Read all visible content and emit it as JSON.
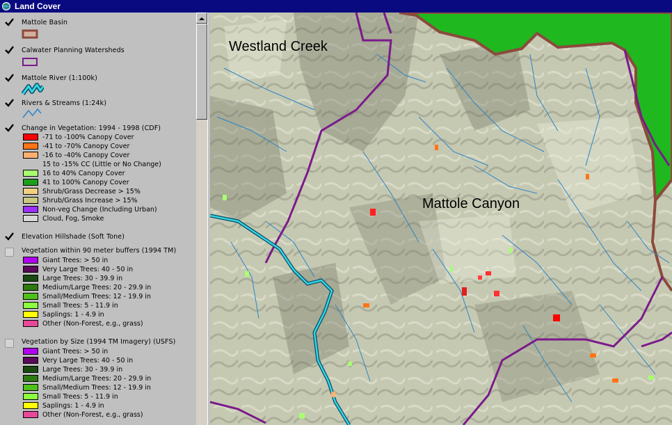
{
  "window": {
    "title": "Land Cover"
  },
  "toc": {
    "layers": [
      {
        "name": "Mattole Basin",
        "checked": true
      },
      {
        "name": "Calwater Planning Watersheds",
        "checked": true
      },
      {
        "name": "Mattole River (1:100k)",
        "checked": true
      },
      {
        "name": "Rivers & Streams (1:24k)",
        "checked": true
      },
      {
        "name": "Change in Vegetation: 1994 - 1998 (CDF)",
        "checked": true,
        "legend": [
          {
            "label": "-71 to -100% Canopy Cover",
            "color": "#ff0000"
          },
          {
            "label": "-41 to -70% Canopy Cover",
            "color": "#ff7518"
          },
          {
            "label": "-16 to -40% Canopy Cover",
            "color": "#ffb070"
          },
          {
            "label": "15 to -15% CC (Little or No Change)",
            "color": ""
          },
          {
            "label": "16 to 40% Canopy Cover",
            "color": "#a8ff70"
          },
          {
            "label": "41 to 100% Canopy Cover",
            "color": "#1e9e1e"
          },
          {
            "label": "Shrub/Grass Decrease > 15%",
            "color": "#f0d080"
          },
          {
            "label": "Shrub/Grass Increase > 15%",
            "color": "#c8c880"
          },
          {
            "label": "Non-veg Change (Including Urban)",
            "color": "#9b30ff"
          },
          {
            "label": "Cloud, Fog, Smoke",
            "color": "#d8d8d8"
          }
        ]
      },
      {
        "name": "Elevation Hillshade (Soft Tone)",
        "checked": true
      },
      {
        "name": "Vegetation within 90 meter buffers (1994 TM)",
        "checked": false,
        "legend": [
          {
            "label": "Giant Trees: > 50 in",
            "color": "#b000f0"
          },
          {
            "label": "Very Large Trees: 40 - 50 in",
            "color": "#5a0a5a"
          },
          {
            "label": "Large Trees: 30 - 39.9 in",
            "color": "#1a4a10"
          },
          {
            "label": "Medium/Large Trees: 20 - 29.9 in",
            "color": "#2e7a10"
          },
          {
            "label": "Small/Medium Trees: 12 - 19.9 in",
            "color": "#4ec01a"
          },
          {
            "label": "Small Trees: 5 - 11.9 in",
            "color": "#8cff40"
          },
          {
            "label": "Saplings: 1 - 4.9 in",
            "color": "#ffff00"
          },
          {
            "label": "Other (Non-Forest, e.g., grass)",
            "color": "#e8489a"
          }
        ]
      },
      {
        "name": "Vegetation by Size (1994 TM Imagery) (USFS)",
        "checked": false,
        "legend": [
          {
            "label": "Giant Trees: > 50 in",
            "color": "#b000f0"
          },
          {
            "label": "Very Large Trees: 40 - 50 in",
            "color": "#5a0a5a"
          },
          {
            "label": "Large Trees: 30 - 39.9 in",
            "color": "#1a4a10"
          },
          {
            "label": "Medium/Large Trees: 20 - 29.9 in",
            "color": "#2e7a10"
          },
          {
            "label": "Small/Medium Trees: 12 - 19.9 in",
            "color": "#4ec01a"
          },
          {
            "label": "Small Trees: 5 - 11.9 in",
            "color": "#8cff40"
          },
          {
            "label": "Saplings: 1 - 4.9 in",
            "color": "#ffff00"
          },
          {
            "label": "Other (Non-Forest, e.g., grass)",
            "color": "#e8489a"
          }
        ]
      }
    ]
  },
  "map": {
    "labels": [
      "Westland Creek",
      "Mattole Canyon"
    ],
    "colors": {
      "basin_boundary": "#8b4a3c",
      "watershed_boundary": "#7a1a8a",
      "river": "#33d7e0",
      "stream": "#2b84c8",
      "outside": "#1fb81f",
      "terrain": "#c6c9b2"
    }
  }
}
